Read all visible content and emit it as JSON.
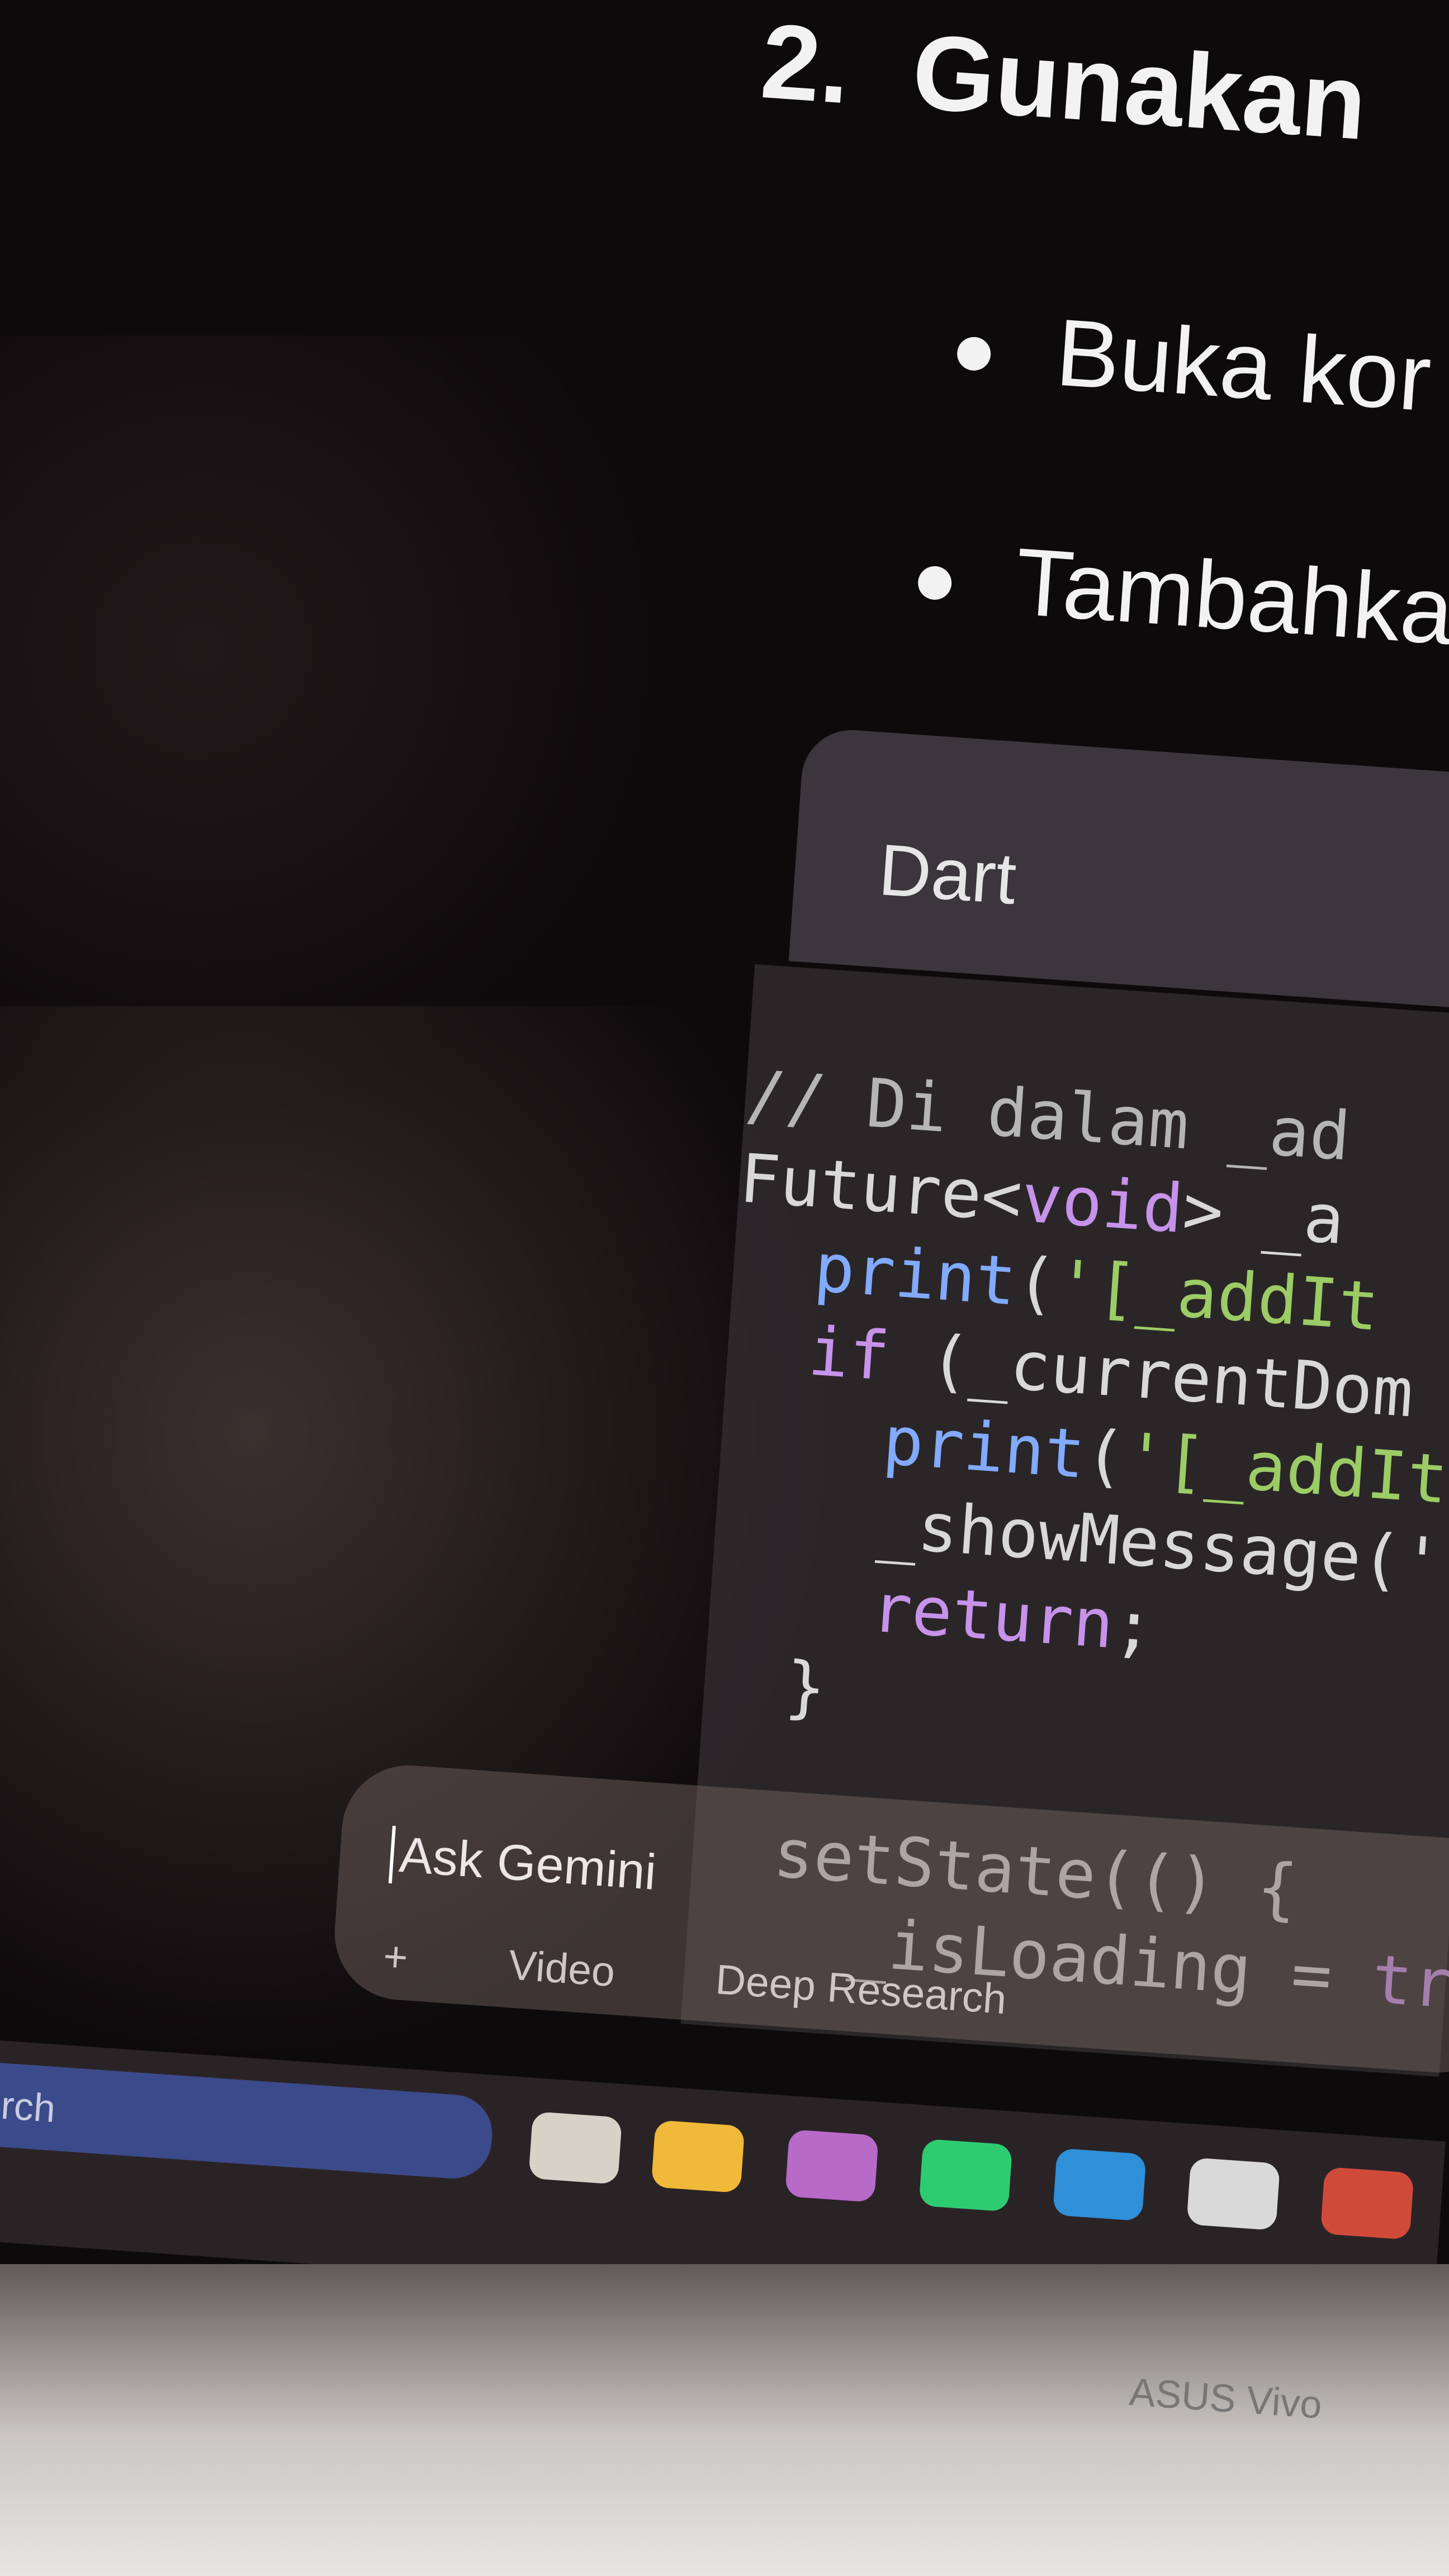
{
  "document": {
    "step_number": "2.",
    "step_title": "Gunakan",
    "bullets": [
      "Buka kor",
      "Tambahka"
    ]
  },
  "code_block": {
    "language": "Dart",
    "lines": [
      {
        "comment": "// Di dalam _ad"
      },
      {
        "plain1": "Future<",
        "kw": "void",
        "plain2": "> _a"
      },
      {
        "fn": "print",
        "plain": "(",
        "str": "'[_addIt"
      },
      {
        "kw": "if",
        "plain": " (_currentDom"
      },
      {
        "fn": "print",
        "plain": "(",
        "str": "'[_addIt"
      },
      {
        "plain": "_showMessage('"
      },
      {
        "kw": "return",
        "plain": ";"
      },
      {
        "plain": "}"
      },
      {
        "plain": ""
      },
      {
        "plain": "setState(() {"
      },
      {
        "plain": "_isLoading = ",
        "kw": "true"
      }
    ]
  },
  "gemini_bar": {
    "placeholder": "Ask Gemini",
    "tools": [
      "+",
      "Video",
      "Deep Research"
    ]
  },
  "taskbar": {
    "search_text": "rch",
    "apps": [
      {
        "icon": "file-explorer-icon",
        "color": "#d6d2c8"
      },
      {
        "icon": "folder-icon",
        "color": "#f0b93a"
      },
      {
        "icon": "copilot-icon",
        "color": "#b86ac9"
      },
      {
        "icon": "spotify-icon",
        "color": "#2ecc71"
      },
      {
        "icon": "edge-icon",
        "color": "#2f8fd8"
      },
      {
        "icon": "store-icon",
        "color": "#d9d9d9"
      },
      {
        "icon": "app-icon",
        "color": "#d04a3a"
      }
    ]
  },
  "laptop": {
    "brand": "ASUS Vivo"
  }
}
